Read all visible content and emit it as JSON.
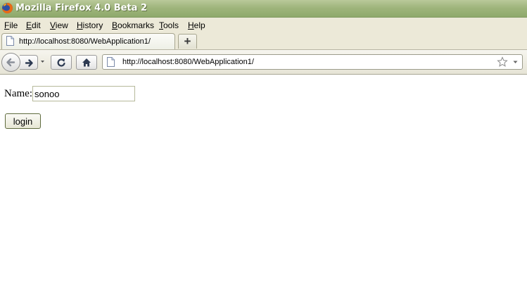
{
  "window": {
    "title": "Mozilla Firefox 4.0 Beta 2"
  },
  "menu": [
    {
      "label": "File",
      "accel": "F",
      "rest": "ile"
    },
    {
      "label": "Edit",
      "accel": "E",
      "rest": "dit"
    },
    {
      "label": "View",
      "accel": "V",
      "rest": "iew"
    },
    {
      "label": "History",
      "accel": "H",
      "rest": "istory"
    },
    {
      "label": "Bookmarks",
      "accel": "B",
      "rest": "ookmarks"
    },
    {
      "label": "Tools",
      "accel": "T",
      "rest": "ools"
    },
    {
      "label": "Help",
      "accel": "H",
      "rest": "elp"
    }
  ],
  "tabs": [
    {
      "label": "http://localhost:8080/WebApplication1/",
      "icon": "page-icon",
      "active": true
    }
  ],
  "newtab": {
    "label": "+"
  },
  "nav": {
    "url": "http://localhost:8080/WebApplication1/",
    "icons": [
      "back-icon",
      "forward-icon",
      "reload-icon",
      "home-icon",
      "bookmark-star-icon"
    ]
  },
  "form": {
    "name_label": "Name:",
    "name_value": "sonoo",
    "login_label": "login"
  },
  "colors": {
    "titlebar": "#9fb57c",
    "chrome": "#ece9d8"
  }
}
